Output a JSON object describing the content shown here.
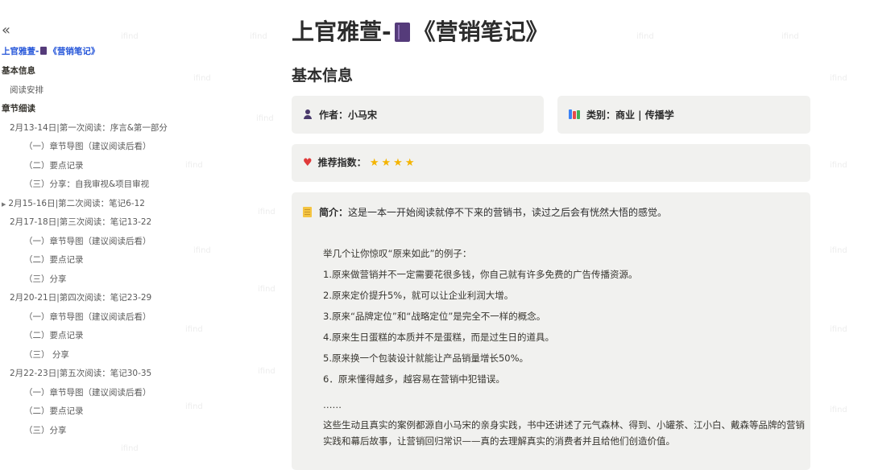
{
  "sidebar": {
    "collapse_icon": "«",
    "title_prefix": "上官雅萱-",
    "title_suffix": "《营销笔记》",
    "items": [
      {
        "label": "基本信息",
        "level": 0
      },
      {
        "label": "阅读安排",
        "level": 1
      },
      {
        "label": "章节细读",
        "level": 0
      },
      {
        "label": "2月13-14日|第一次阅读：序言&第一部分",
        "level": 1
      },
      {
        "label": "（一）章节导图（建议阅读后看）",
        "level": 2
      },
      {
        "label": "（二）要点记录",
        "level": 2
      },
      {
        "label": "（三）分享：自我审视&项目审视",
        "level": 2
      },
      {
        "label": "2月15-16日|第二次阅读：笔记6-12",
        "level": 1,
        "collapsed": true
      },
      {
        "label": "2月17-18日|第三次阅读：笔记13-22",
        "level": 1
      },
      {
        "label": "（一）章节导图（建议阅读后看）",
        "level": 2
      },
      {
        "label": "（二）要点记录",
        "level": 2
      },
      {
        "label": "（三）分享",
        "level": 2
      },
      {
        "label": "2月20-21日|第四次阅读：笔记23-29",
        "level": 1
      },
      {
        "label": "（一）章节导图（建议阅读后看）",
        "level": 2
      },
      {
        "label": "（二）要点记录",
        "level": 2
      },
      {
        "label": "（三） 分享",
        "level": 2
      },
      {
        "label": "2月22-23日|第五次阅读：笔记30-35",
        "level": 1
      },
      {
        "label": "（一）章节导图（建议阅读后看）",
        "level": 2
      },
      {
        "label": "（二）要点记录",
        "level": 2
      },
      {
        "label": "（三）分享",
        "level": 2
      }
    ]
  },
  "main": {
    "title_prefix": "上官雅萱-",
    "title_suffix": "《营销笔记》",
    "section_heading": "基本信息",
    "author": "作者：小马宋",
    "category": "类别：商业 | 传播学",
    "rating_label": "推荐指数：",
    "rating_stars": 4,
    "intro_label": "简介：",
    "intro_text": "这是一本一开始阅读就停不下来的营销书，读过之后会有恍然大悟的感觉。",
    "examples_heading": "举几个让你惊叹“原来如此”的例子：",
    "examples": [
      "1.原来做营销并不一定需要花很多钱，你自己就有许多免费的广告传播资源。",
      "2.原来定价提升5%，就可以让企业利润大增。",
      "3.原来“品牌定位”和“战略定位”是完全不一样的概念。",
      "4.原来生日蛋糕的本质并不是蛋糕，而是过生日的道具。",
      "5.原来换一个包装设计就能让产品销量增长50%。",
      "6．原来懂得越多，越容易在营销中犯错误。"
    ],
    "ellipsis": "……",
    "closing": "这些生动且真实的案例都源自小马宋的亲身实践，书中还讲述了元气森林、得到、小罐茶、江小白、戴森等品牌的营销实践和幕后故事，让营销回归常识——真的去理解真实的消费者并且给他们创造价值。"
  },
  "watermark": "ifind",
  "colors": {
    "link": "#2455d9",
    "card_bg": "#f1f1ef",
    "star": "#f4b400",
    "heart": "#e03a3a"
  }
}
